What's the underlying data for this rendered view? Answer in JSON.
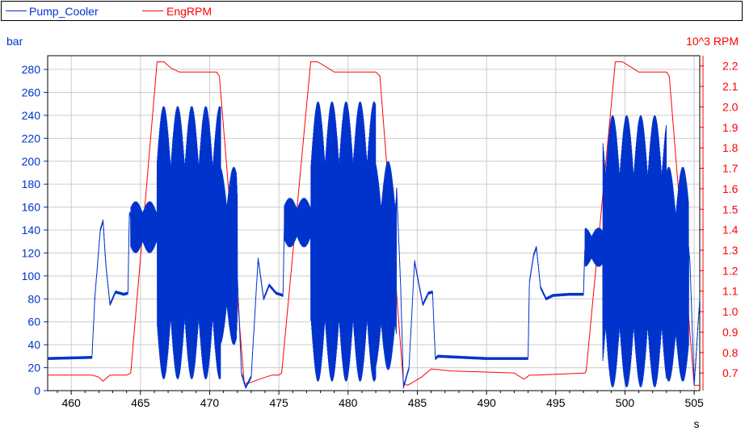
{
  "chart_data": {
    "type": "line",
    "title": "",
    "xlabel": "s",
    "ylabel_left": "bar",
    "ylabel_right": "10^3 RPM",
    "x_range": [
      458.3,
      505.4
    ],
    "y_left_range": [
      0,
      292
    ],
    "y_right_range": [
      0.614,
      2.25
    ],
    "grid": true,
    "legend_position": "top",
    "x_ticks": [
      "460",
      "465",
      "470",
      "475",
      "480",
      "485",
      "490",
      "495",
      "500",
      "505"
    ],
    "y_left_ticks": [
      "0",
      "20",
      "40",
      "60",
      "80",
      "100",
      "120",
      "140",
      "160",
      "180",
      "200",
      "220",
      "240",
      "260",
      "280"
    ],
    "y_right_ticks": [
      "0.7",
      "0.8",
      "0.9",
      "1.0",
      "1.1",
      "1.2",
      "1.3",
      "1.4",
      "1.5",
      "1.6",
      "1.7",
      "1.8",
      "1.9",
      "2.0",
      "2.1",
      "2.2"
    ],
    "series": [
      {
        "name": "Pump_Cooler",
        "axis": "left",
        "color": "#0033cc",
        "x": [
          458.3,
          461.5,
          461.7,
          462.1,
          462.3,
          462.5,
          462.8,
          463.2,
          463.8,
          464.1,
          464.2,
          464.3,
          465.0,
          466.0,
          466.2,
          466.5,
          467.0,
          468.0,
          469.0,
          470.0,
          471.0,
          471.7,
          472.0,
          472.3,
          472.6,
          473.0,
          473.5,
          473.9,
          474.3,
          474.8,
          475.3,
          475.4,
          476.5,
          477.2,
          477.5,
          478.0,
          479.0,
          480.0,
          481.0,
          482.0,
          483.0,
          483.5,
          483.8,
          484.0,
          484.4,
          484.8,
          485.0,
          485.4,
          485.8,
          486.1,
          486.3,
          486.5,
          490.0,
          493.0,
          493.1,
          493.4,
          493.6,
          493.9,
          494.3,
          494.8,
          496.0,
          497.0,
          497.1,
          497.3,
          498.5,
          499.0,
          500.0,
          501.0,
          502.0,
          503.0,
          503.8,
          504.4,
          504.7,
          505.0,
          505.4
        ],
        "y": [
          28,
          29,
          80,
          140,
          148,
          110,
          75,
          86,
          84,
          85,
          155,
          152,
          150,
          145,
          170,
          175,
          215,
          240,
          240,
          232,
          205,
          180,
          100,
          15,
          3,
          12,
          115,
          80,
          92,
          85,
          83,
          150,
          160,
          170,
          172,
          218,
          245,
          250,
          250,
          248,
          205,
          178,
          90,
          3,
          20,
          113,
          100,
          75,
          85,
          86,
          28,
          30,
          28,
          28,
          95,
          118,
          125,
          90,
          80,
          83,
          84,
          84,
          123,
          132,
          128,
          215,
          240,
          238,
          236,
          230,
          190,
          155,
          110,
          5,
          80
        ],
        "oscillations": [
          {
            "x_range": [
              464.3,
              466.2
            ],
            "low": 120,
            "high": 165
          },
          {
            "x_range": [
              466.2,
              470.8
            ],
            "low": 10,
            "high": 248
          },
          {
            "x_range": [
              470.8,
              472.0
            ],
            "low": 40,
            "high": 195
          },
          {
            "x_range": [
              475.4,
              477.3
            ],
            "low": 125,
            "high": 168
          },
          {
            "x_range": [
              477.3,
              482.0
            ],
            "low": 8,
            "high": 252
          },
          {
            "x_range": [
              482.0,
              483.5
            ],
            "low": 18,
            "high": 200
          },
          {
            "x_range": [
              497.1,
              498.4
            ],
            "low": 108,
            "high": 142
          },
          {
            "x_range": [
              498.4,
              503.0
            ],
            "low": 3,
            "high": 240
          },
          {
            "x_range": [
              503.0,
              504.6
            ],
            "low": 8,
            "high": 195
          }
        ]
      },
      {
        "name": "EngRPM",
        "axis": "right",
        "color": "#ff0000",
        "x": [
          458.3,
          461.5,
          462.0,
          462.3,
          462.8,
          464.0,
          464.3,
          466.2,
          466.7,
          467.2,
          467.8,
          468.5,
          470.5,
          470.7,
          472.5,
          472.8,
          473.6,
          474.5,
          475.0,
          475.2,
          477.3,
          477.8,
          478.3,
          479.0,
          482.0,
          482.3,
          484.0,
          484.3,
          485.3,
          486.0,
          487.5,
          492.0,
          492.7,
          493.1,
          493.6,
          497.0,
          497.1,
          497.2,
          499.3,
          499.8,
          500.3,
          501.0,
          503.0,
          503.2,
          505.0,
          505.4
        ],
        "y": [
          0.69,
          0.69,
          0.68,
          0.66,
          0.69,
          0.69,
          0.7,
          2.22,
          2.22,
          2.19,
          2.17,
          2.17,
          2.17,
          2.15,
          0.65,
          0.65,
          0.67,
          0.69,
          0.69,
          0.7,
          2.22,
          2.22,
          2.2,
          2.17,
          2.17,
          2.15,
          0.65,
          0.64,
          0.68,
          0.72,
          0.71,
          0.7,
          0.67,
          0.69,
          0.69,
          0.7,
          0.7,
          0.71,
          2.22,
          2.22,
          2.2,
          2.17,
          2.17,
          2.15,
          0.64,
          0.64
        ]
      }
    ]
  }
}
